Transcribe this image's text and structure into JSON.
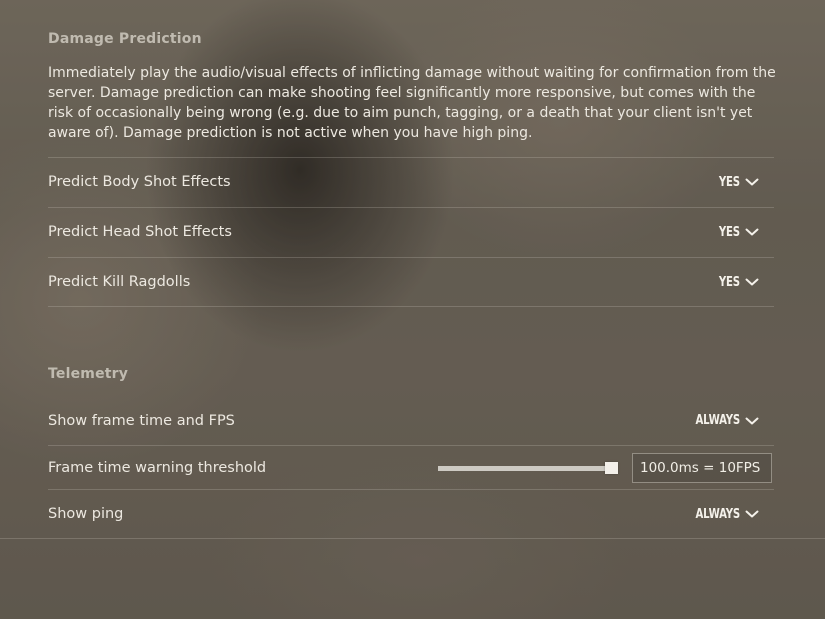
{
  "damage_prediction": {
    "title": "Damage Prediction",
    "description": "Immediately play the audio/visual effects of inflicting damage without waiting for confirmation from the server. Damage prediction can make shooting feel significantly more responsive, but comes with the risk of occasionally being wrong (e.g. due to aim punch, tagging, or a death that your client isn't yet aware of). Damage prediction is not active when you have high ping.",
    "settings": [
      {
        "label": "Predict Body Shot Effects",
        "value": "YES"
      },
      {
        "label": "Predict Head Shot Effects",
        "value": "YES"
      },
      {
        "label": "Predict Kill Ragdolls",
        "value": "YES"
      }
    ]
  },
  "telemetry": {
    "title": "Telemetry",
    "frame_time": {
      "label": "Show frame time and FPS",
      "value": "ALWAYS"
    },
    "threshold": {
      "label": "Frame time warning threshold",
      "value_text": "100.0ms = 10FPS",
      "slider_fraction": 1.0
    },
    "ping": {
      "label": "Show ping",
      "value": "ALWAYS"
    }
  },
  "icons": {
    "dropdown": "chevron-down-icon"
  }
}
